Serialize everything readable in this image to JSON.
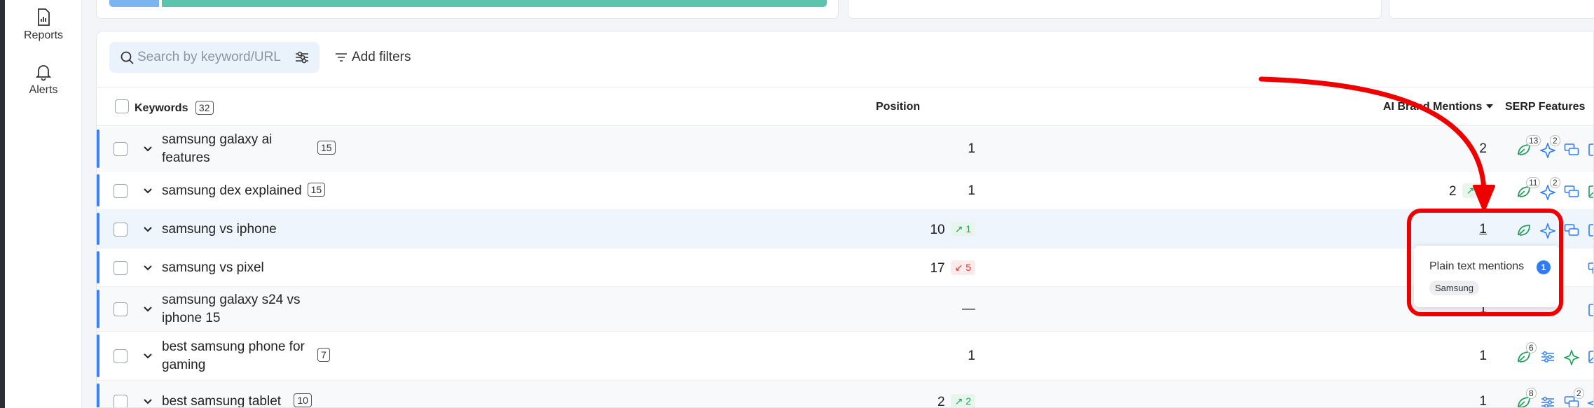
{
  "sidebar": {
    "items": [
      {
        "label": "Reports",
        "icon": "reports-icon"
      },
      {
        "label": "Alerts",
        "icon": "bell-icon"
      }
    ]
  },
  "progress": {
    "blue_fraction": 0.07,
    "green_fraction": 0.93,
    "colors": {
      "blue": "#7cb4f2",
      "green": "#5cc3ac"
    }
  },
  "toolbar": {
    "search_placeholder": "Search by keyword/URL",
    "add_filters_label": "Add filters"
  },
  "table": {
    "headers": {
      "keywords": "Keywords",
      "keywords_count": "32",
      "position": "Position",
      "ai_mentions": "AI Brand Mentions",
      "serp_features": "SERP Features"
    },
    "rows": [
      {
        "keyword_line1": "samsung galaxy ai",
        "keyword_line2": "features",
        "badge": "15",
        "position": "1",
        "change": "",
        "ai": "2",
        "ai_change": ""
      },
      {
        "keyword_line1": "samsung dex explained",
        "keyword_line2": "",
        "badge": "15",
        "position": "1",
        "change": "",
        "ai": "2",
        "ai_change": "1"
      },
      {
        "keyword_line1": "samsung vs iphone",
        "keyword_line2": "",
        "badge": "",
        "position": "10",
        "change": "1",
        "ai": "1",
        "ai_change": ""
      },
      {
        "keyword_line1": "samsung vs pixel",
        "keyword_line2": "",
        "badge": "",
        "position": "17",
        "change": "5",
        "ai": "",
        "ai_change": ""
      },
      {
        "keyword_line1": "samsung galaxy s24 vs",
        "keyword_line2": "iphone 15",
        "badge": "",
        "position": "—",
        "change": "",
        "ai": "1",
        "ai_change": ""
      },
      {
        "keyword_line1": "best samsung phone for",
        "keyword_line2": "gaming",
        "badge": "7",
        "position": "1",
        "change": "",
        "ai": "1",
        "ai_change": ""
      },
      {
        "keyword_line1": "best samsung tablet",
        "keyword_line2": "",
        "badge": "10",
        "position": "2",
        "change": "2",
        "ai": "1",
        "ai_change": ""
      }
    ],
    "serp_counts": {
      "r1_leaf": "13",
      "r1_ai": "2",
      "r2_leaf": "11",
      "r2_ai": "2",
      "r6_leaf": "6",
      "r7_leaf": "8",
      "r7_ai": "2"
    }
  },
  "tooltip": {
    "title": "Plain text mentions",
    "count": "1",
    "brand": "Samsung"
  },
  "colors": {
    "accent": "#3b82f6",
    "up": "#1e9e56",
    "down": "#e03131",
    "annotation": "#ee0000"
  }
}
